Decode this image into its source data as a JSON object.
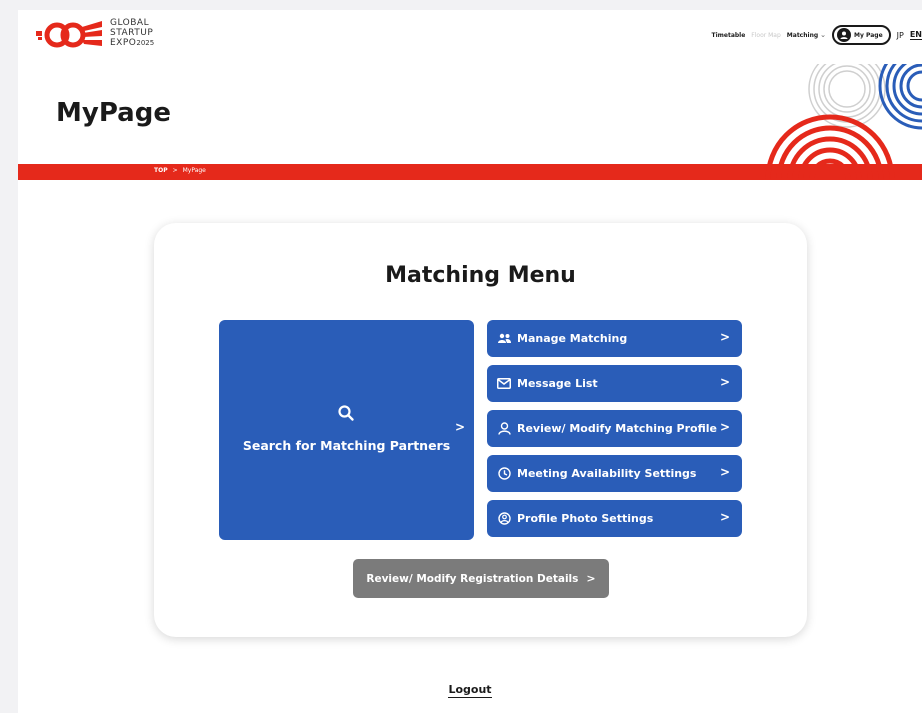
{
  "header": {
    "logo": {
      "line1": "GLOBAL",
      "line2": "STARTUP",
      "line3": "EXPO",
      "year": "2025"
    },
    "nav": {
      "timetable": "Timetable",
      "floor_map": "Floor Map",
      "matching": "Matching",
      "my_page": "My Page",
      "lang_jp": "JP",
      "lang_en": "EN"
    }
  },
  "hero": {
    "title": "MyPage"
  },
  "breadcrumb": {
    "top": "TOP",
    "separator": ">",
    "current": "MyPage"
  },
  "card": {
    "title": "Matching Menu",
    "search": {
      "label": "Search for Matching Partners",
      "icon": "search-icon"
    },
    "menu": [
      {
        "label": "Manage Matching",
        "icon": "users-icon"
      },
      {
        "label": "Message List",
        "icon": "envelope-icon"
      },
      {
        "label": "Review/ Modify Matching Profile",
        "icon": "user-icon"
      },
      {
        "label": "Meeting Availability Settings",
        "icon": "clock-icon"
      },
      {
        "label": "Profile Photo Settings",
        "icon": "user-circle-icon"
      }
    ],
    "arrow": ">",
    "registration_button": "Review/ Modify Registration Details"
  },
  "footer": {
    "logout": "Logout"
  },
  "colors": {
    "brand_red": "#e5291b",
    "brand_blue": "#2a5db8",
    "button_gray": "#7b7b7b"
  }
}
